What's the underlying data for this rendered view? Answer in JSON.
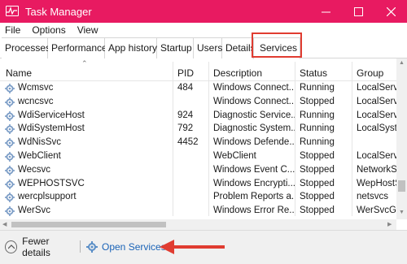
{
  "window": {
    "title": "Task Manager"
  },
  "menu": [
    "File",
    "Options",
    "View"
  ],
  "tabs": [
    "Processes",
    "Performance",
    "App history",
    "Startup",
    "Users",
    "Details",
    "Services"
  ],
  "active_tab": "Services",
  "columns": {
    "name": "Name",
    "pid": "PID",
    "description": "Description",
    "status": "Status",
    "group": "Group"
  },
  "rows": [
    {
      "name": "Wcmsvc",
      "pid": "484",
      "description": "Windows Connect...",
      "status": "Running",
      "group": "LocalServi"
    },
    {
      "name": "wcncsvc",
      "pid": "",
      "description": "Windows Connect...",
      "status": "Stopped",
      "group": "LocalServi"
    },
    {
      "name": "WdiServiceHost",
      "pid": "924",
      "description": "Diagnostic Service...",
      "status": "Running",
      "group": "LocalServi"
    },
    {
      "name": "WdiSystemHost",
      "pid": "792",
      "description": "Diagnostic System...",
      "status": "Running",
      "group": "LocalSyste"
    },
    {
      "name": "WdNisSvc",
      "pid": "4452",
      "description": "Windows Defende...",
      "status": "Running",
      "group": ""
    },
    {
      "name": "WebClient",
      "pid": "",
      "description": "WebClient",
      "status": "Stopped",
      "group": "LocalServi"
    },
    {
      "name": "Wecsvc",
      "pid": "",
      "description": "Windows Event C...",
      "status": "Stopped",
      "group": "NetworkS"
    },
    {
      "name": "WEPHOSTSVC",
      "pid": "",
      "description": "Windows Encrypti...",
      "status": "Stopped",
      "group": "WepHostS"
    },
    {
      "name": "wercplsupport",
      "pid": "",
      "description": "Problem Reports a...",
      "status": "Stopped",
      "group": "netsvcs"
    },
    {
      "name": "WerSvc",
      "pid": "",
      "description": "Windows Error Re...",
      "status": "Stopped",
      "group": "WerSvcGr"
    }
  ],
  "footer": {
    "fewer_details": "Fewer details",
    "open_services": "Open Services"
  },
  "colors": {
    "titlebar": "#e81a61",
    "highlight": "#e03c31",
    "link": "#1a63b7"
  },
  "icons": {
    "app": "task-manager-icon",
    "service": "gear-icon",
    "fewer": "chevron-up-icon",
    "open": "services-icon"
  }
}
